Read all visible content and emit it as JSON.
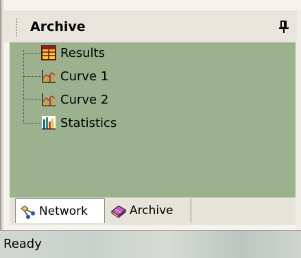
{
  "panel": {
    "title": "Archive",
    "pin_icon": "pin-icon"
  },
  "tree": {
    "items": [
      {
        "label": "Results",
        "icon": "table-icon"
      },
      {
        "label": "Curve 1",
        "icon": "curve-chart-icon"
      },
      {
        "label": "Curve 2",
        "icon": "curve-chart-icon"
      },
      {
        "label": "Statistics",
        "icon": "statistics-chart-icon"
      }
    ]
  },
  "tabs": [
    {
      "label": "Network",
      "icon": "network-icon",
      "active": true
    },
    {
      "label": "Archive",
      "icon": "book-icon",
      "active": false
    }
  ],
  "status": {
    "text": "Ready"
  },
  "colors": {
    "tree_background": "#9cb28f",
    "header_background": "#e8e6dc",
    "tab_active": "#ffffff"
  }
}
